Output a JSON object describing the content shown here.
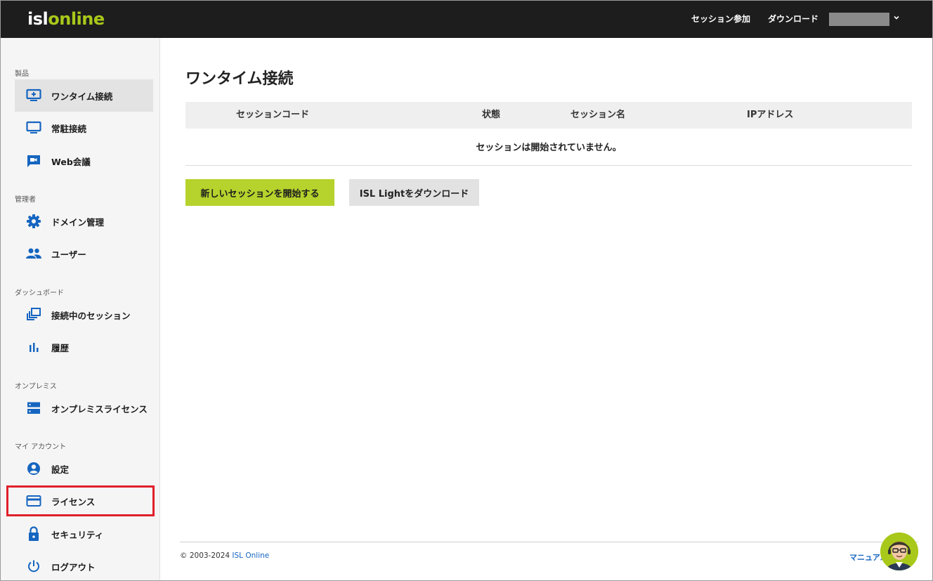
{
  "header": {
    "logo_part1": "isl",
    "logo_part2": "online",
    "nav_join": "セッション参加",
    "nav_download": "ダウンロード"
  },
  "sidebar": {
    "sections": [
      {
        "title": "製品"
      },
      {
        "title": "管理者"
      },
      {
        "title": "ダッシュボード"
      },
      {
        "title": "オンプレミス"
      },
      {
        "title": "マイ アカウント"
      }
    ],
    "items": [
      {
        "label": "ワンタイム接続",
        "icon": "monitor-plus-icon",
        "active": true
      },
      {
        "label": "常駐接続",
        "icon": "monitor-icon"
      },
      {
        "label": "Web会議",
        "icon": "video-camera-icon"
      },
      {
        "label": "ドメイン管理",
        "icon": "gear-icon"
      },
      {
        "label": "ユーザー",
        "icon": "users-icon"
      },
      {
        "label": "接続中のセッション",
        "icon": "session-stack-icon"
      },
      {
        "label": "履歴",
        "icon": "bar-chart-icon"
      },
      {
        "label": "オンプレミスライセンス",
        "icon": "server-icon"
      },
      {
        "label": "設定",
        "icon": "account-circle-icon"
      },
      {
        "label": "ライセンス",
        "icon": "credit-card-icon",
        "highlighted": true
      },
      {
        "label": "セキュリティ",
        "icon": "lock-icon"
      },
      {
        "label": "ログアウト",
        "icon": "power-icon"
      }
    ]
  },
  "main": {
    "title": "ワンタイム接続",
    "table": {
      "columns": [
        "セッションコード",
        "状態",
        "セッション名",
        "IPアドレス"
      ],
      "empty_message": "セッションは開始されていません。"
    },
    "primary_button": "新しいセッションを開始する",
    "secondary_button": "ISL Lightをダウンロード"
  },
  "footer": {
    "copyright": "© 2003-2024 ",
    "company_link": "ISL Online",
    "manual_link": "マニュアル"
  },
  "colors": {
    "topbar": "#1d1d1d",
    "brand_green": "#a8c81a",
    "button_green": "#b6d22c",
    "icon_blue": "#1565c0",
    "highlight_red": "#e0202a"
  }
}
